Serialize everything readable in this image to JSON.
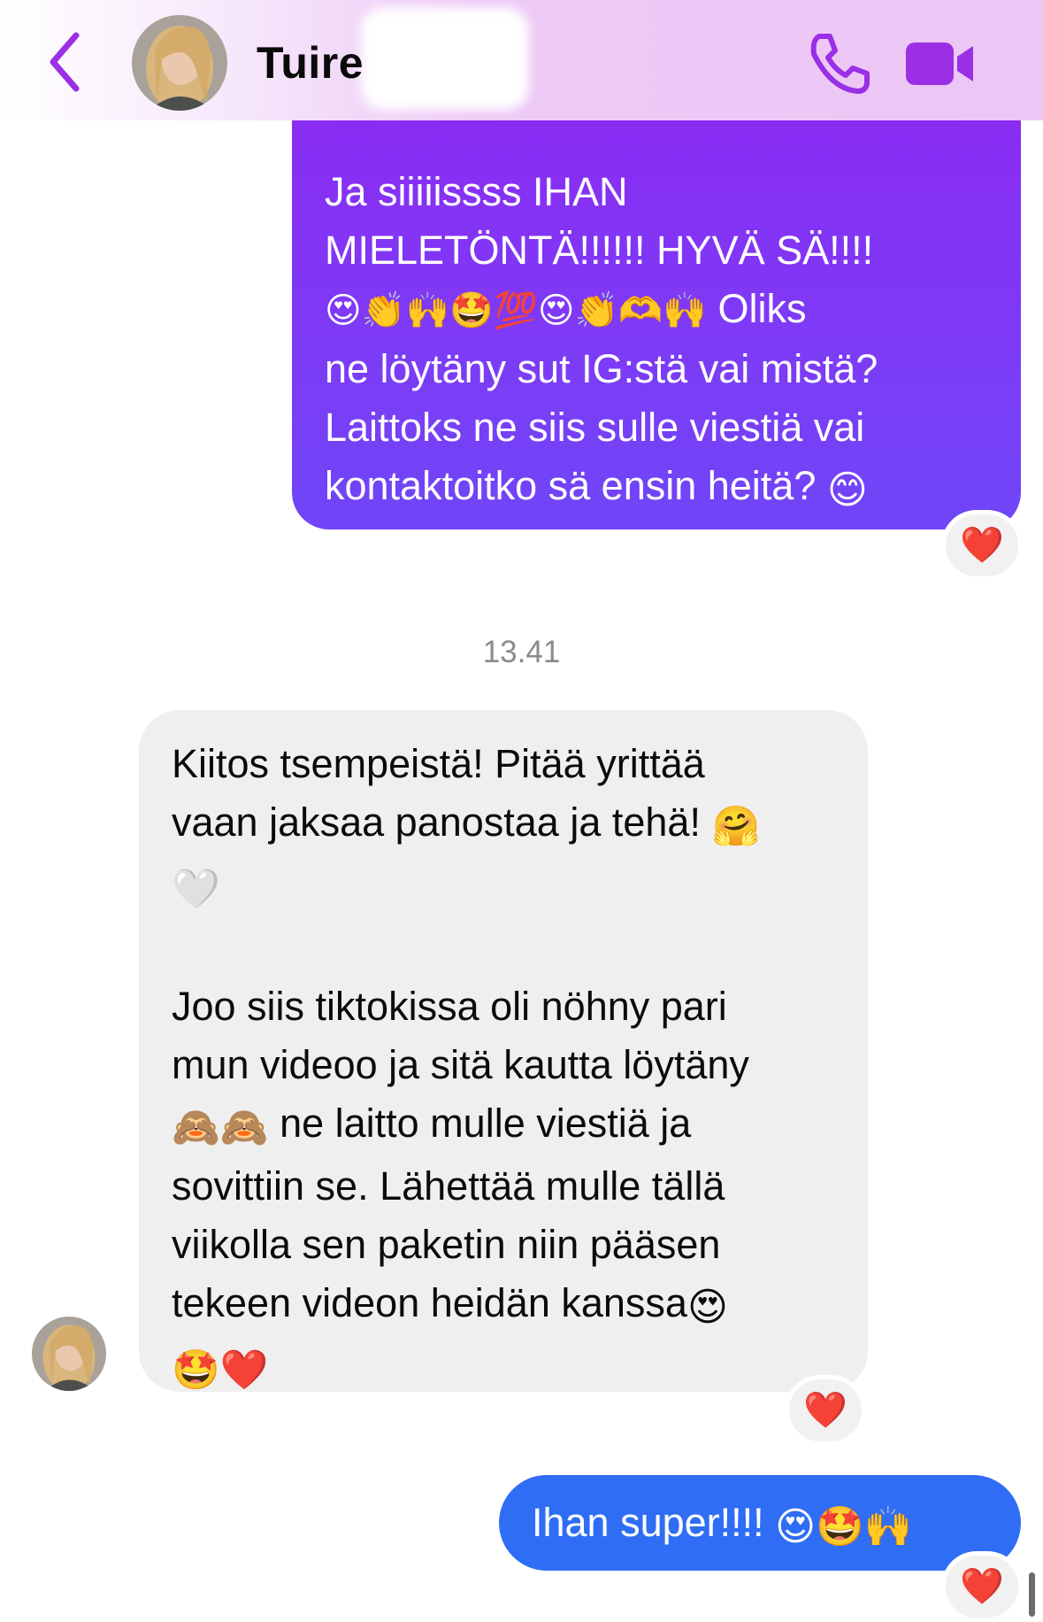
{
  "header": {
    "contact_name": "Tuire",
    "icons": {
      "back": "chevron-left-icon",
      "call": "phone-icon",
      "video": "video-camera-icon"
    },
    "accent_color": "#9a2fe6"
  },
  "messages": {
    "m1": {
      "direction": "outgoing",
      "l1": "Ja siiiiissss IHAN",
      "l2": "MIELETÖNTÄ!!!!!! HYVÄ SÄ!!!!",
      "l3_emoji": "😍👏🙌🤩💯😍👏🫶🙌",
      "l3_text": " Oliks",
      "l4": "ne löytäny sut IG:stä vai mistä?",
      "l5": "Laittoks ne siis sulle viestiä vai",
      "l6_text": "kontaktoitko sä ensin heitä? ",
      "l6_emoji": "😊",
      "reaction": "❤️"
    },
    "timestamp": "13.41",
    "m2": {
      "direction": "incoming",
      "l1": "Kiitos tsempeistä! Pitää yrittää",
      "l2_text": "vaan jaksaa panostaa ja tehä! ",
      "l2_emoji": "🤗",
      "l3_emoji": "🤍",
      "l4": "Joo siis tiktokissa oli nöhny pari",
      "l5": "mun videoo ja sitä kautta löytäny",
      "l6_emoji": "🙈🙈",
      "l6_text": " ne laitto mulle viestiä ja",
      "l7": "sovittiin se. Lähettää mulle tällä",
      "l8": "viikolla sen paketin niin pääsen",
      "l9_text": "tekeen videon heidän kanssa",
      "l9_emoji": "😍",
      "l10_emoji": "🤩❤️",
      "reaction": "❤️"
    },
    "m3": {
      "direction": "outgoing",
      "text": "Ihan super!!!! ",
      "emoji": "😍🤩🙌",
      "reaction": "❤️"
    }
  },
  "colors": {
    "outgoing_purple": "#8a2cf3",
    "outgoing_blue": "#2f6df5",
    "incoming_gray": "#efefef",
    "reaction_heart": "#e8232f"
  }
}
